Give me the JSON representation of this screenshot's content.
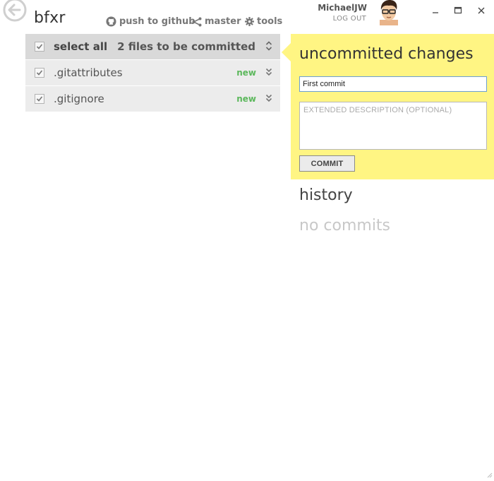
{
  "repo": {
    "name": "bfxr"
  },
  "toolbar": {
    "push_label": "push to github",
    "branch_label": "master",
    "tools_label": "tools"
  },
  "user": {
    "name": "MichaelJW",
    "logout_label": "LOG OUT"
  },
  "files": {
    "select_all_label": "select all",
    "count_label": "2 files to be committed",
    "items": [
      {
        "name": ".gitattributes",
        "status": "new",
        "checked": true
      },
      {
        "name": ".gitignore",
        "status": "new",
        "checked": true
      }
    ]
  },
  "commit_panel": {
    "title": "uncommitted changes",
    "summary_value": "First commit",
    "description_placeholder": "EXTENDED DESCRIPTION (OPTIONAL)",
    "commit_button_label": "COMMIT",
    "background_color": "#fff583"
  },
  "history": {
    "title": "history",
    "empty_label": "no commits"
  },
  "colors": {
    "status_new": "#5cb85c",
    "accent": "#fff583"
  }
}
